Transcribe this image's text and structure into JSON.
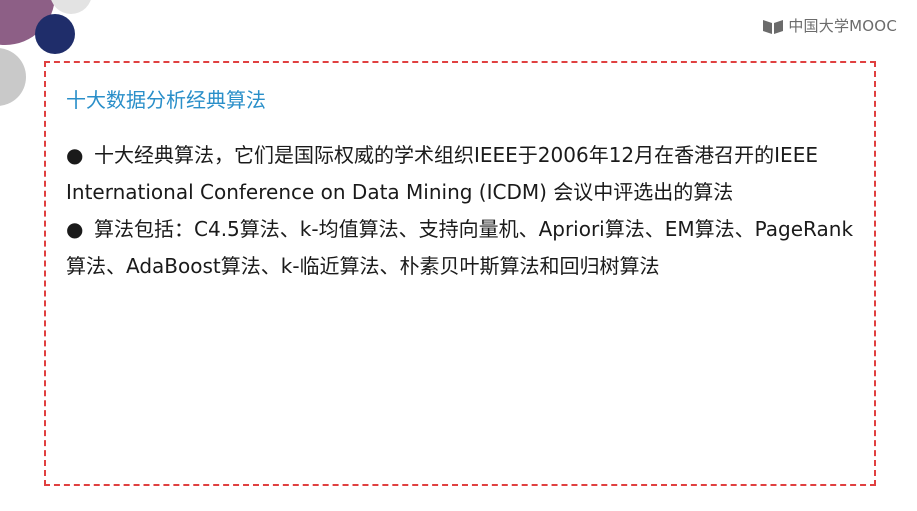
{
  "brand": {
    "logo_text": "中国大学MOOC"
  },
  "slide": {
    "heading": "十大数据分析经典算法",
    "bullets": [
      {
        "marker": "●",
        "text": "十大经典算法，它们是国际权威的学术组织IEEE于2006年12月在香港召开的IEEE International Conference on Data Mining (ICDM) 会议中评选出的算法"
      },
      {
        "marker": "●",
        "text": "算法包括：C4.5算法、k-均值算法、支持向量机、Apriori算法、EM算法、PageRank算法、AdaBoost算法、k-临近算法、朴素贝叶斯算法和回归树算法"
      }
    ]
  },
  "colors": {
    "heading": "#2a8fc9",
    "frame_border": "#e04040",
    "text": "#1a1a1a",
    "deco_purple": "#8d5f86",
    "deco_navy": "#1f2d6a"
  }
}
